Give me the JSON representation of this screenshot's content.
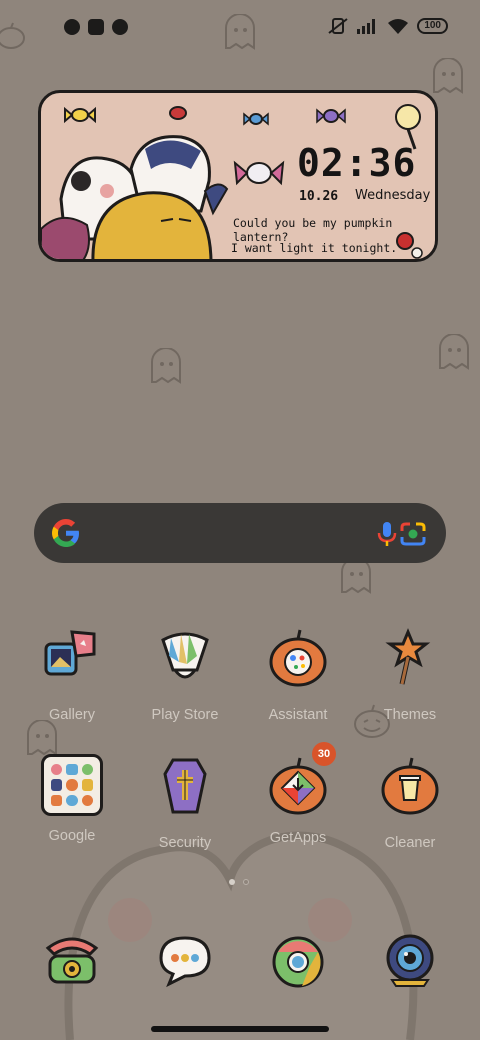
{
  "status_bar": {
    "battery": "100",
    "icons": [
      "app-notification-icon",
      "square-icon",
      "app-notification-icon",
      "mute-vibrate-icon",
      "signal-icon",
      "wifi-icon"
    ]
  },
  "widget": {
    "time": "02:36",
    "date": "10.26",
    "weekday": "Wednesday",
    "quote_line1": "Could you be my pumpkin lantern?",
    "quote_line2": "I want light it tonight."
  },
  "search": {
    "logo_icon": "google-g-icon",
    "voice_icon": "mic-icon",
    "lens_icon": "camera-lens-icon"
  },
  "apps_row1": [
    {
      "label": "Gallery",
      "icon": "gallery-icon"
    },
    {
      "label": "Play Store",
      "icon": "play-store-icon"
    },
    {
      "label": "Assistant",
      "icon": "assistant-icon"
    },
    {
      "label": "Themes",
      "icon": "themes-icon"
    }
  ],
  "apps_row2": [
    {
      "label": "Google",
      "icon": "google-folder-icon"
    },
    {
      "label": "Security",
      "icon": "security-icon"
    },
    {
      "label": "GetApps",
      "icon": "getapps-icon",
      "badge": "30"
    },
    {
      "label": "Cleaner",
      "icon": "cleaner-icon"
    }
  ],
  "dock": [
    {
      "icon": "phone-icon"
    },
    {
      "icon": "messages-icon"
    },
    {
      "icon": "chrome-icon"
    },
    {
      "icon": "camera-icon"
    }
  ],
  "colors": {
    "wallpaper": "#8f857c",
    "widget_bg": "#e2c4b4",
    "search_bg": "#3a3836",
    "pumpkin": "#e27a3f",
    "badge": "#d9542a"
  }
}
